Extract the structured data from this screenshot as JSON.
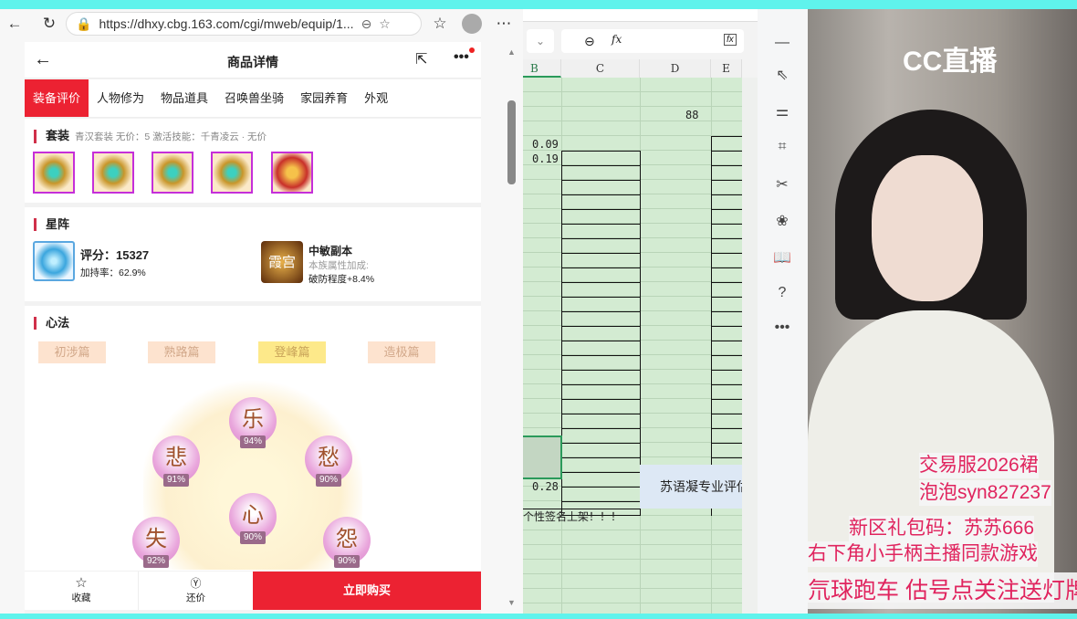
{
  "browser": {
    "url": "https://dhxy.cbg.163.com/cgi/mweb/equip/1...",
    "icons": [
      "back-icon",
      "refresh-icon",
      "lock-icon",
      "zoom-out-icon",
      "star-icon",
      "favorites-icon",
      "profile-icon",
      "more-icon"
    ]
  },
  "page": {
    "title": "商品详情",
    "tabs": [
      "装备评价",
      "人物修为",
      "物品道具",
      "召唤兽坐骑",
      "家园养育",
      "外观"
    ],
    "suit": {
      "label": "套装",
      "info": "青汉套装  无价：5  激活技能：千青凌云 · 无价"
    },
    "star": {
      "label": "星阵",
      "score": "评分：15327",
      "rate": "加持率：62.9%",
      "name": "中敏副本",
      "sub": "本族属性加成:",
      "bonus": "破防程度+8.4%",
      "emblem": "霞宫"
    },
    "xinfa": {
      "label": "心法",
      "levels": [
        "初涉篇",
        "熟路篇",
        "登峰篇",
        "造极篇"
      ],
      "nodes": [
        {
          "c": "乐",
          "p": "94%"
        },
        {
          "c": "悲",
          "p": "91%"
        },
        {
          "c": "愁",
          "p": "90%"
        },
        {
          "c": "心",
          "p": "90%"
        },
        {
          "c": "失",
          "p": "92%"
        },
        {
          "c": "怨",
          "p": "90%"
        }
      ]
    },
    "bottom": {
      "fav": "收藏",
      "bargain": "还价",
      "buy": "立即购买"
    }
  },
  "sheet": {
    "fx": "fx",
    "cols": [
      "B",
      "C",
      "D",
      "E"
    ],
    "cells": {
      "d88": "88",
      "b1": "0.09",
      "b2": "0.19",
      "b3": "0.28",
      "eval": "苏语凝专业评估",
      "sig": "个性签名上架！！！"
    }
  },
  "video": {
    "logo": "CC直播",
    "lines": [
      "交易服2026裙",
      "泡泡syn827237",
      "新区礼包码：苏苏666",
      "右下角小手柄主播同款游戏",
      "氘球跑车   估号点关注送灯牌"
    ]
  },
  "colors": {
    "accent": "#ec2232",
    "sheet": "#d3ebd2",
    "overlay": "#e0245e"
  }
}
